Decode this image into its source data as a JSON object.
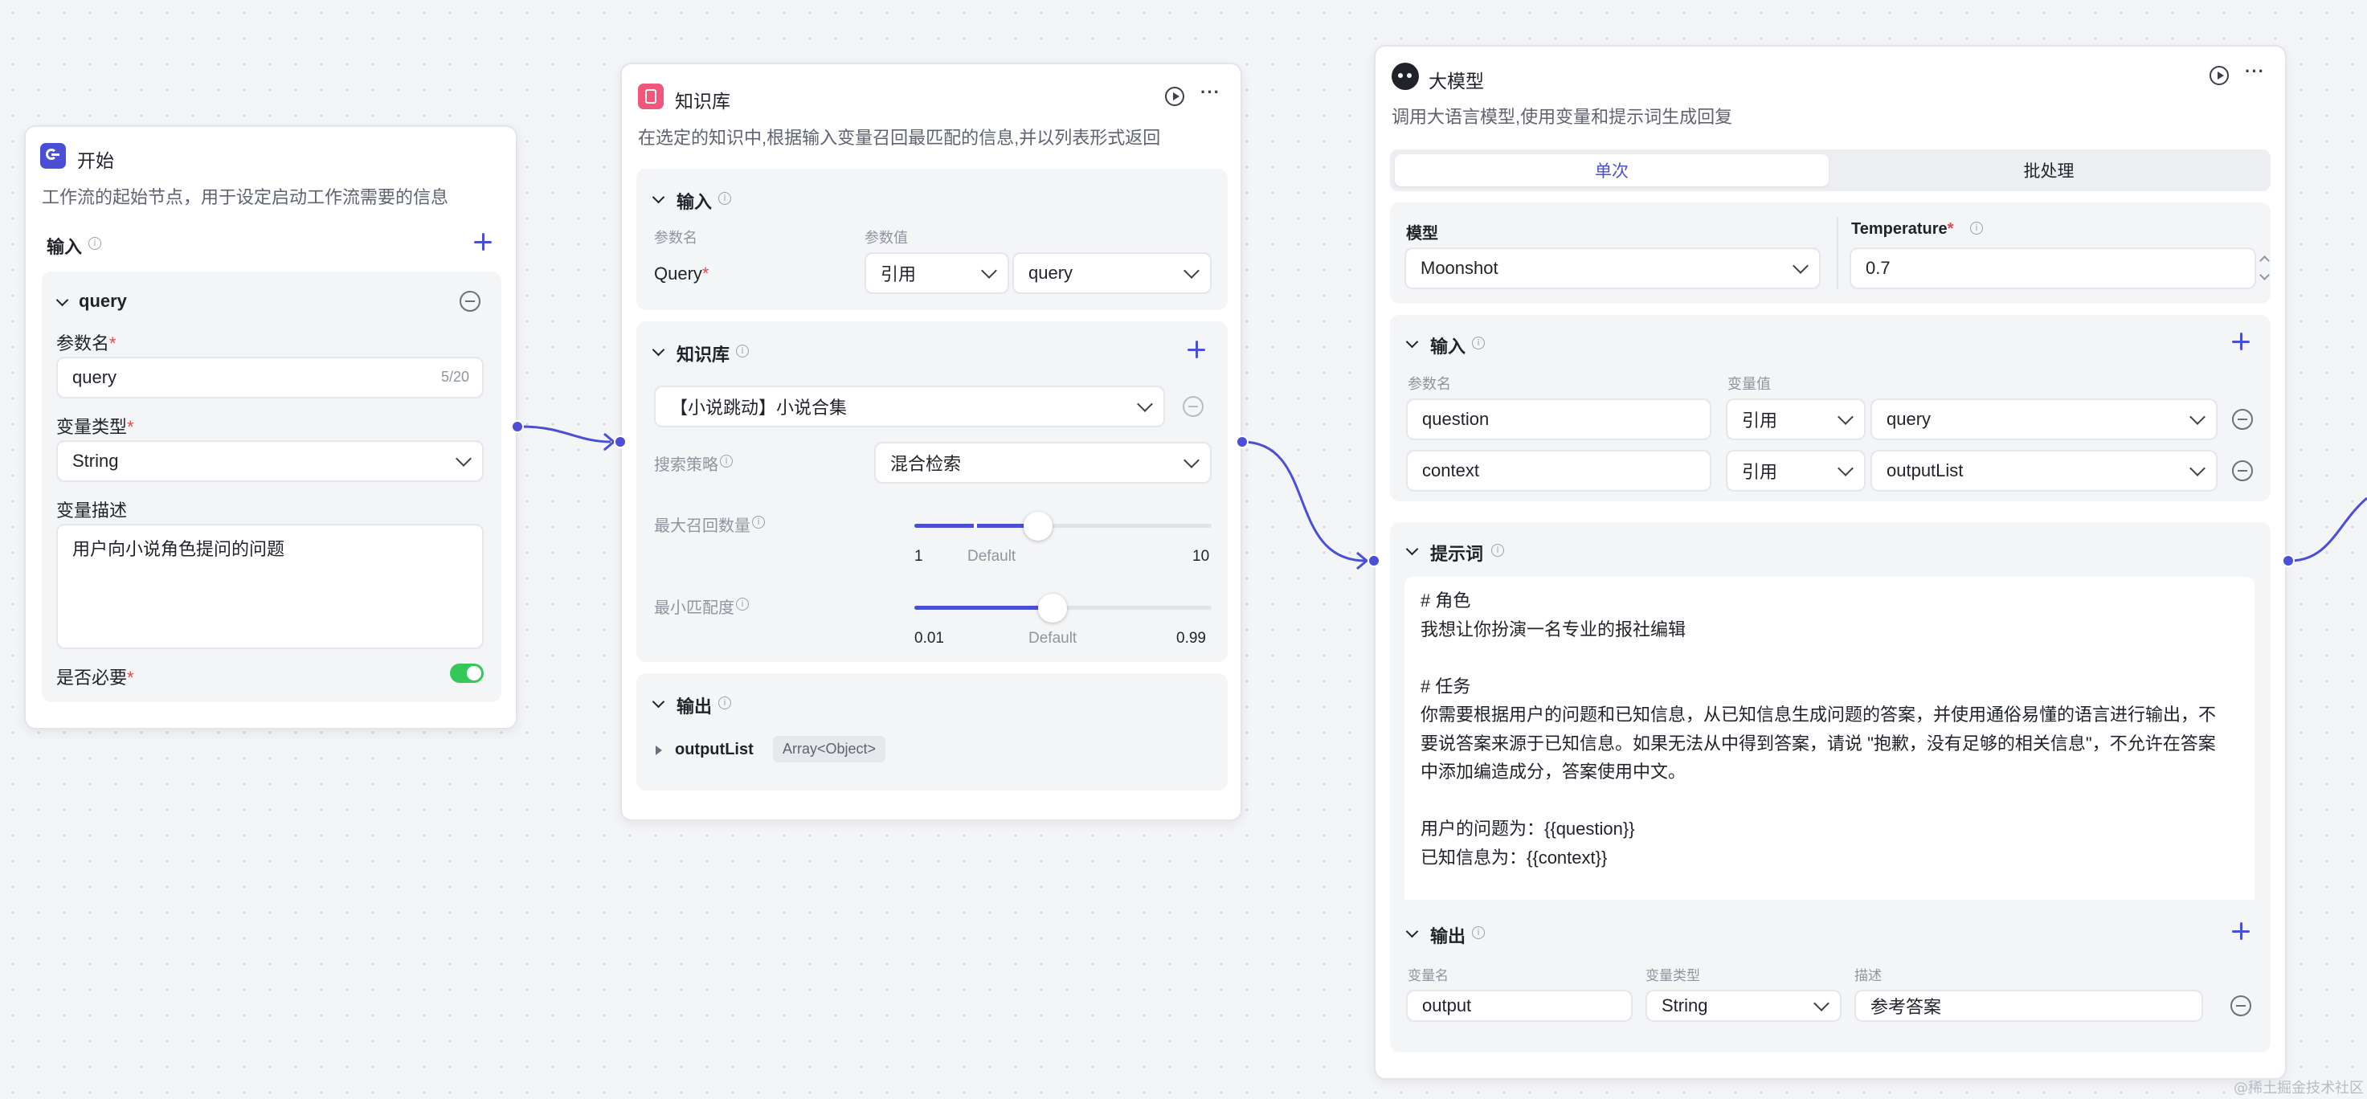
{
  "start_node": {
    "title": "开始",
    "description": "工作流的起始节点，用于设定启动工作流需要的信息",
    "input_label": "输入",
    "param": {
      "name": "query",
      "param_name_label": "参数名",
      "param_name_value": "query",
      "char_count": "5/20",
      "var_type_label": "变量类型",
      "var_type_value": "String",
      "var_desc_label": "变量描述",
      "var_desc_value": "用户向小说角色提问的问题",
      "required_label": "是否必要",
      "required_on": true
    }
  },
  "knowledge_node": {
    "title": "知识库",
    "description": "在选定的知识中,根据输入变量召回最匹配的信息,并以列表形式返回",
    "input_section": {
      "label": "输入",
      "col_param_name": "参数名",
      "col_param_value": "参数值",
      "row_label": "Query",
      "ref_type": "引用",
      "ref_value": "query"
    },
    "kb_section": {
      "label": "知识库",
      "selected": "【小说跳动】小说合集",
      "strategy_label": "搜索策略",
      "strategy_value": "混合检索",
      "max_recall_label": "最大召回数量",
      "max_recall": {
        "min": "1",
        "default_label": "Default",
        "max": "10",
        "value": 5
      },
      "min_match_label": "最小匹配度",
      "min_match": {
        "min": "0.01",
        "default_label": "Default",
        "max": "0.99",
        "value": 0.5
      }
    },
    "output_section": {
      "label": "输出",
      "var_name": "outputList",
      "var_type": "Array<Object>"
    }
  },
  "llm_node": {
    "title": "大模型",
    "description": "调用大语言模型,使用变量和提示词生成回复",
    "tabs": [
      "单次",
      "批处理"
    ],
    "active_tab": "单次",
    "model_label": "模型",
    "model_value": "Moonshot",
    "temperature_label": "Temperature",
    "temperature_value": "0.7",
    "input_section": {
      "label": "输入",
      "col_param_name": "参数名",
      "col_var_value": "变量值",
      "rows": [
        {
          "name": "question",
          "ref_type": "引用",
          "ref_value": "query"
        },
        {
          "name": "context",
          "ref_type": "引用",
          "ref_value": "outputList"
        }
      ]
    },
    "prompt_section": {
      "label": "提示词",
      "lines": [
        "# 角色",
        "我想让你扮演一名专业的报社编辑",
        "",
        "# 任务",
        "你需要根据用户的问题和已知信息，从已知信息生成问题的答案，并使用通俗易懂的语言进行输出，不",
        "要说答案来源于已知信息。如果无法从中得到答案，请说 \"抱歉，没有足够的相关信息\"，不允许在答案",
        "中添加编造成分，答案使用中文。",
        "",
        "用户的问题为：{{question}}",
        "已知信息为：{{context}}"
      ]
    },
    "output_section": {
      "label": "输出",
      "col_var_name": "变量名",
      "col_var_type": "变量类型",
      "col_desc": "描述",
      "var_name": "output",
      "var_type": "String",
      "var_desc": "参考答案"
    }
  },
  "watermark": "@稀土掘金技术社区",
  "colors": {
    "accent": "#4a4fd6",
    "toggle_on": "#34c759",
    "start_icon": "#4a4fd6",
    "kb_icon": "#f0577a"
  }
}
